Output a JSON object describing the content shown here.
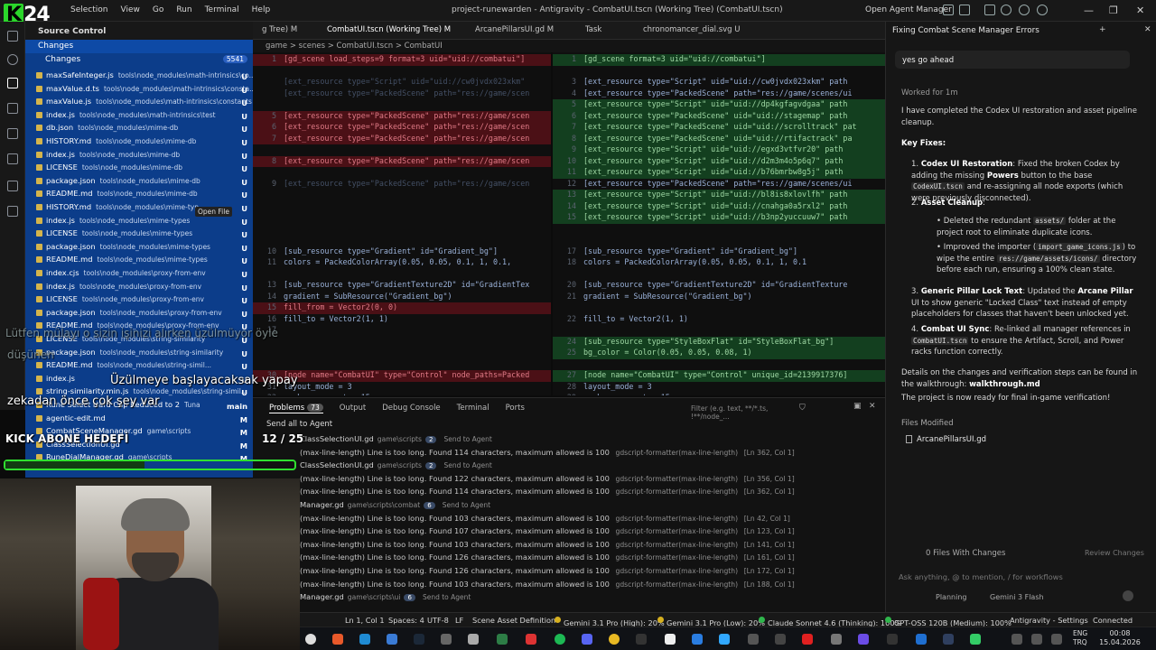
{
  "window": {
    "title": "project-runewarden - Antigravity - CombatUI.tscn (Working Tree) (CombatUI.tscn)",
    "menu": [
      "File",
      "Edit",
      "Selection",
      "View",
      "Go",
      "Run",
      "Terminal",
      "Help"
    ],
    "open_agent_manager": "Open Agent Manager"
  },
  "logo": {
    "k": "K",
    "num": "24"
  },
  "sidebar": {
    "title": "Source Control",
    "changes_section": "Changes",
    "changes_group": "Changes",
    "changes_count": "5541",
    "files": [
      {
        "name": "maxSafeInteger.js",
        "path": "tools\\node_modules\\math-intrinsics\\co...",
        "status": "U"
      },
      {
        "name": "maxValue.d.ts",
        "path": "tools\\node_modules\\math-intrinsics\\consta...",
        "status": "U"
      },
      {
        "name": "maxValue.js",
        "path": "tools\\node_modules\\math-intrinsics\\constants",
        "status": "U"
      },
      {
        "name": "index.js",
        "path": "tools\\node_modules\\math-intrinsics\\test",
        "status": "U"
      },
      {
        "name": "db.json",
        "path": "tools\\node_modules\\mime-db",
        "status": "U"
      },
      {
        "name": "HISTORY.md",
        "path": "tools\\node_modules\\mime-db",
        "status": "U"
      },
      {
        "name": "index.js",
        "path": "tools\\node_modules\\mime-db",
        "status": "U"
      },
      {
        "name": "LICENSE",
        "path": "tools\\node_modules\\mime-db",
        "status": "U"
      },
      {
        "name": "package.json",
        "path": "tools\\node_modules\\mime-db",
        "status": "U"
      },
      {
        "name": "README.md",
        "path": "tools\\node_modules\\mime-db",
        "status": "U"
      },
      {
        "name": "HISTORY.md",
        "path": "tools\\node_modules\\mime-typ",
        "status": "U"
      },
      {
        "name": "index.js",
        "path": "tools\\node_modules\\mime-types",
        "status": "U"
      },
      {
        "name": "LICENSE",
        "path": "tools\\node_modules\\mime-types",
        "status": "U"
      },
      {
        "name": "package.json",
        "path": "tools\\node_modules\\mime-types",
        "status": "U"
      },
      {
        "name": "README.md",
        "path": "tools\\node_modules\\mime-types",
        "status": "U"
      },
      {
        "name": "index.cjs",
        "path": "tools\\node_modules\\proxy-from-env",
        "status": "U"
      },
      {
        "name": "index.js",
        "path": "tools\\node_modules\\proxy-from-env",
        "status": "U"
      },
      {
        "name": "LICENSE",
        "path": "tools\\node_modules\\proxy-from-env",
        "status": "U"
      },
      {
        "name": "package.json",
        "path": "tools\\node_modules\\proxy-from-env",
        "status": "U"
      },
      {
        "name": "README.md",
        "path": "tools\\node_modules\\proxy-from-env",
        "status": "U"
      },
      {
        "name": "LICENSE",
        "path": "tools\\node_modules\\string-similarity",
        "status": "U"
      },
      {
        "name": "package.json",
        "path": "tools\\node_modules\\string-similarity",
        "status": "U"
      },
      {
        "name": "README.md",
        "path": "tools\\node_modules\\string-simil...",
        "status": "U"
      },
      {
        "name": "index.js",
        "path": "",
        "status": "U"
      },
      {
        "name": "string-similarity.min.js",
        "path": "tools\\node_modules\\string-simil...",
        "status": "U"
      },
      {
        "name": "Rune Select Hard Cap Reduced to 2",
        "path": "Tuna",
        "status": "main"
      },
      {
        "name": "agentic-edit.md",
        "path": "",
        "status": "M"
      },
      {
        "name": "CombatSceneManager.gd",
        "path": "game\\scripts",
        "status": "M"
      },
      {
        "name": "ClassSelectionUI.gd",
        "path": "",
        "status": "M"
      },
      {
        "name": "RuneDialManager.gd",
        "path": "game\\scripts",
        "status": "M"
      }
    ],
    "tooltip": "Open File"
  },
  "tabs": [
    {
      "label": "g Tree) M"
    },
    {
      "label": "CombatUI.tscn (Working Tree) M"
    },
    {
      "label": "ArcanePillarsUI.gd M"
    },
    {
      "label": "Task"
    },
    {
      "label": "chronomancer_dial.svg U"
    }
  ],
  "breadcrumb": "game > scenes > CombatUI.tscn > CombatUI",
  "editor_left": [
    {
      "n": "1",
      "t": "[gd_scene load_steps=9 format=3 uid=\"uid://combatui\"]",
      "k": "del"
    },
    {
      "n": "",
      "t": "",
      "k": ""
    },
    {
      "n": "",
      "t": "[ext_resource type=\"Script\" uid=\"uid://cw0jvdx023xkm\"",
      "k": "dim"
    },
    {
      "n": "",
      "t": "[ext_resource type=\"PackedScene\" path=\"res://game/scen",
      "k": "dim"
    },
    {
      "n": "",
      "t": "",
      "k": ""
    },
    {
      "n": "5",
      "t": "[ext_resource type=\"PackedScene\" path=\"res://game/scen",
      "k": "del"
    },
    {
      "n": "6",
      "t": "[ext_resource type=\"PackedScene\" path=\"res://game/scen",
      "k": "del"
    },
    {
      "n": "7",
      "t": "[ext_resource type=\"PackedScene\" path=\"res://game/scen",
      "k": "del"
    },
    {
      "n": "",
      "t": "",
      "k": ""
    },
    {
      "n": "8",
      "t": "[ext_resource type=\"PackedScene\" path=\"res://game/scen",
      "k": "del"
    },
    {
      "n": "",
      "t": "",
      "k": ""
    },
    {
      "n": "9",
      "t": "[ext_resource type=\"PackedScene\" path=\"res://game/scen",
      "k": "dim"
    },
    {
      "n": "",
      "t": "",
      "k": ""
    },
    {
      "n": "",
      "t": "",
      "k": ""
    },
    {
      "n": "",
      "t": "",
      "k": ""
    },
    {
      "n": "",
      "t": "",
      "k": ""
    },
    {
      "n": "",
      "t": "",
      "k": ""
    },
    {
      "n": "10",
      "t": "[sub_resource type=\"Gradient\" id=\"Gradient_bg\"]",
      "k": ""
    },
    {
      "n": "11",
      "t": "colors = PackedColorArray(0.05, 0.05, 0.1, 1, 0.1,",
      "k": ""
    },
    {
      "n": "",
      "t": "",
      "k": ""
    },
    {
      "n": "13",
      "t": "[sub_resource type=\"GradientTexture2D\" id=\"GradientTex",
      "k": ""
    },
    {
      "n": "14",
      "t": "gradient = SubResource(\"Gradient_bg\")",
      "k": ""
    },
    {
      "n": "15",
      "t": "fill_from = Vector2(0, 0)",
      "k": "del"
    },
    {
      "n": "16",
      "t": "fill_to = Vector2(1, 1)",
      "k": ""
    },
    {
      "n": "17",
      "t": "",
      "k": ""
    },
    {
      "n": "",
      "t": "",
      "k": ""
    },
    {
      "n": "",
      "t": "",
      "k": ""
    },
    {
      "n": "",
      "t": "",
      "k": ""
    },
    {
      "n": "30",
      "t": "[node name=\"CombatUI\" type=\"Control\" node_paths=Packed",
      "k": "del"
    },
    {
      "n": "31",
      "t": "layout_mode = 3",
      "k": ""
    },
    {
      "n": "32",
      "t": "anchors_preset = 15",
      "k": ""
    }
  ],
  "editor_right": [
    {
      "n": "1",
      "t": "[gd_scene format=3 uid=\"uid://combatui\"]",
      "k": "add"
    },
    {
      "n": "",
      "t": "",
      "k": ""
    },
    {
      "n": "3",
      "t": "[ext_resource type=\"Script\" uid=\"uid://cw0jvdx023xkm\" path",
      "k": ""
    },
    {
      "n": "4",
      "t": "[ext_resource type=\"PackedScene\" path=\"res://game/scenes/ui",
      "k": ""
    },
    {
      "n": "5",
      "t": "[ext_resource type=\"Script\" uid=\"uid://dp4kgfagvdgaa\" path",
      "k": "add"
    },
    {
      "n": "6",
      "t": "[ext_resource type=\"PackedScene\" uid=\"uid://stagemap\" path",
      "k": "add"
    },
    {
      "n": "7",
      "t": "[ext_resource type=\"PackedScene\" uid=\"uid://scrolltrack\" pat",
      "k": "add"
    },
    {
      "n": "8",
      "t": "[ext_resource type=\"PackedScene\" uid=\"uid://rtifactrack\" pa",
      "k": "add"
    },
    {
      "n": "9",
      "t": "[ext_resource type=\"Script\" uid=\"uid://egxd3vtfvr20\" path",
      "k": "add"
    },
    {
      "n": "10",
      "t": "[ext_resource type=\"Script\" uid=\"uid://d2m3m4o5p6q7\" path",
      "k": "add"
    },
    {
      "n": "11",
      "t": "[ext_resource type=\"Script\" uid=\"uid://b76bmrbw8g5j\" path",
      "k": "add"
    },
    {
      "n": "12",
      "t": "[ext_resource type=\"PackedScene\" path=\"res://game/scenes/ui",
      "k": ""
    },
    {
      "n": "13",
      "t": "[ext_resource type=\"Script\" uid=\"uid://bl8is8xlovlfh\" path",
      "k": "add"
    },
    {
      "n": "14",
      "t": "[ext_resource type=\"Script\" uid=\"uid://cnahga0a5rxl2\" path",
      "k": "add"
    },
    {
      "n": "15",
      "t": "[ext_resource type=\"Script\" uid=\"uid://b3np2yuccuuw7\" path",
      "k": "add"
    },
    {
      "n": "",
      "t": "",
      "k": ""
    },
    {
      "n": "",
      "t": "",
      "k": ""
    },
    {
      "n": "17",
      "t": "[sub_resource type=\"Gradient\" id=\"Gradient_bg\"]",
      "k": ""
    },
    {
      "n": "18",
      "t": "colors = PackedColorArray(0.05, 0.05, 0.1, 1, 0.1",
      "k": ""
    },
    {
      "n": "",
      "t": "",
      "k": ""
    },
    {
      "n": "20",
      "t": "[sub_resource type=\"GradientTexture2D\" id=\"GradientTexture",
      "k": ""
    },
    {
      "n": "21",
      "t": "gradient = SubResource(\"Gradient_bg\")",
      "k": ""
    },
    {
      "n": "",
      "t": "",
      "k": ""
    },
    {
      "n": "22",
      "t": "fill_to = Vector2(1, 1)",
      "k": ""
    },
    {
      "n": "",
      "t": "",
      "k": ""
    },
    {
      "n": "24",
      "t": "[sub_resource type=\"StyleBoxFlat\" id=\"StyleBoxFlat_bg\"]",
      "k": "add"
    },
    {
      "n": "25",
      "t": "bg_color = Color(0.05, 0.05, 0.08, 1)",
      "k": "add"
    },
    {
      "n": "",
      "t": "",
      "k": ""
    },
    {
      "n": "27",
      "t": "[node name=\"CombatUI\" type=\"Control\" unique_id=2139917376]",
      "k": "add"
    },
    {
      "n": "28",
      "t": "layout_mode = 3",
      "k": ""
    },
    {
      "n": "29",
      "t": "anchors_preset = 15",
      "k": ""
    }
  ],
  "panel": {
    "tabs": [
      "Problems",
      "Output",
      "Debug Console",
      "Terminal",
      "Ports"
    ],
    "problems_count": "73",
    "filter_placeholder": "Filter (e.g. text, **/*.ts, !**/node_...",
    "send_all": "Send all to Agent",
    "rows": [
      {
        "type": "file",
        "msg": "ClassSelectionUI.gd",
        "group": "game\\scripts",
        "badge": "2",
        "send": "Send to Agent"
      },
      {
        "type": "msg",
        "msg": "(max-line-length) Line is too long. Found 114 characters, maximum allowed is 100",
        "src": "gdscript-formatter(max-line-length)",
        "pos": "[Ln 362, Col 1]"
      },
      {
        "type": "file",
        "msg": "ClassSelectionUI.gd",
        "group": "game\\scripts",
        "badge": "2",
        "send": "Send to Agent"
      },
      {
        "type": "msg",
        "msg": "(max-line-length) Line is too long. Found 122 characters, maximum allowed is 100",
        "src": "gdscript-formatter(max-line-length)",
        "pos": "[Ln 356, Col 1]"
      },
      {
        "type": "msg",
        "msg": "(max-line-length) Line is too long. Found 114 characters, maximum allowed is 100",
        "src": "gdscript-formatter(max-line-length)",
        "pos": "[Ln 362, Col 1]"
      },
      {
        "type": "file",
        "msg": "Manager.gd",
        "group": "game\\scripts\\combat",
        "badge": "6",
        "send": "Send to Agent"
      },
      {
        "type": "msg",
        "msg": "(max-line-length) Line is too long. Found 103 characters, maximum allowed is 100",
        "src": "gdscript-formatter(max-line-length)",
        "pos": "[Ln 42, Col 1]"
      },
      {
        "type": "msg",
        "msg": "(max-line-length) Line is too long. Found 107 characters, maximum allowed is 100",
        "src": "gdscript-formatter(max-line-length)",
        "pos": "[Ln 123, Col 1]"
      },
      {
        "type": "msg",
        "msg": "(max-line-length) Line is too long. Found 103 characters, maximum allowed is 100",
        "src": "gdscript-formatter(max-line-length)",
        "pos": "[Ln 141, Col 1]"
      },
      {
        "type": "msg",
        "msg": "(max-line-length) Line is too long. Found 126 characters, maximum allowed is 100",
        "src": "gdscript-formatter(max-line-length)",
        "pos": "[Ln 161, Col 1]"
      },
      {
        "type": "msg",
        "msg": "(max-line-length) Line is too long. Found 126 characters, maximum allowed is 100",
        "src": "gdscript-formatter(max-line-length)",
        "pos": "[Ln 172, Col 1]"
      },
      {
        "type": "msg",
        "msg": "(max-line-length) Line is too long. Found 103 characters, maximum allowed is 100",
        "src": "gdscript-formatter(max-line-length)",
        "pos": "[Ln 188, Col 1]"
      },
      {
        "type": "file",
        "msg": "Manager.gd",
        "group": "game\\scripts\\ui",
        "badge": "6",
        "send": "Send to Agent"
      }
    ]
  },
  "agent": {
    "header": "Fixing Combat Scene Manager Errors",
    "user_message": "yes go ahead",
    "worked": "Worked for 1m",
    "intro": "I have completed the Codex UI restoration and asset pipeline cleanup.",
    "key_fixes": "Key Fixes:",
    "f1_title": "Codex UI Restoration",
    "f1_a": ": Fixed the broken Codex by adding the missing ",
    "f1_b": "Powers",
    "f1_c": " button to the base ",
    "f1_code": "CodexUI.tscn",
    "f1_d": " and re-assigning all node exports (which were previously disconnected).",
    "f2_title": "Asset Cleanup",
    "f2_b1a": "Deleted the redundant ",
    "f2_b1code": "assets/",
    "f2_b1b": " folder at the project root to eliminate duplicate icons.",
    "f2_b2a": "Improved the importer (",
    "f2_b2code": "import_game_icons.js",
    "f2_b2b": ") to wipe the entire ",
    "f2_b2code2": "res://game/assets/icons/",
    "f2_b2c": " directory before each run, ensuring a 100% clean state.",
    "f3_title": "Generic Pillar Lock Text",
    "f3_a": ": Updated the ",
    "f3_b": "Arcane Pillar",
    "f3_c": " UI to show generic \"Locked Class\" text instead of empty placeholders for classes that haven't been unlocked yet.",
    "f4_title": "Combat UI Sync",
    "f4_a": ": Re-linked all manager references in ",
    "f4_code": "CombatUI.tscn",
    "f4_b": " to ensure the Artifact, Scroll, and Power racks function correctly.",
    "details": "Details on the changes and verification steps can be found in the walkthrough: ",
    "walkthrough": "walkthrough.md",
    "ready": "The project is now ready for final in-game verification!",
    "files_modified": "Files Modified",
    "file1": "ArcanePillarsUI.gd",
    "files_changes": "0 Files With Changes",
    "review": "Review Changes",
    "ask_placeholder": "Ask anything, @ to mention, / for workflows",
    "planning": "Planning",
    "model": "Gemini 3 Flash"
  },
  "status": {
    "ln": "Ln 1, Col 1",
    "spaces": "Spaces: 4",
    "enc": "UTF-8",
    "eol": "LF",
    "lang": "Scene Asset Definition",
    "q1": "Gemini 3.1 Pro (High): 20%",
    "q2": "Gemini 3.1 Pro (Low): 20%",
    "q3": "Claude Sonnet 4.6 (Thinking): 100%",
    "q4": "GPT-OSS 120B (Medium): 100%",
    "settings": "Antigravity - Settings",
    "conn": "Connected"
  },
  "clock": {
    "lang1": "ENG",
    "lang2": "TRQ",
    "time": "00:08",
    "date": "15.04.2026"
  },
  "overlay": {
    "chat1": "Lütfen mülayı o sizin işinizi alırken üzülmüyor öyle",
    "chat2": "düşünen",
    "chat3": "Üzülmeye başlayacaksak yapay",
    "chat4": "zekadan önce çok şey var",
    "goal": "KICK ABONE HEDEFİ",
    "goal_count": "12 / 25",
    "goal_progress": 0.48
  },
  "colors": {
    "sidebar": "#0c3d8a",
    "accent": "#2bd62b",
    "deleted": "#4b1016",
    "added": "#133f1f"
  }
}
